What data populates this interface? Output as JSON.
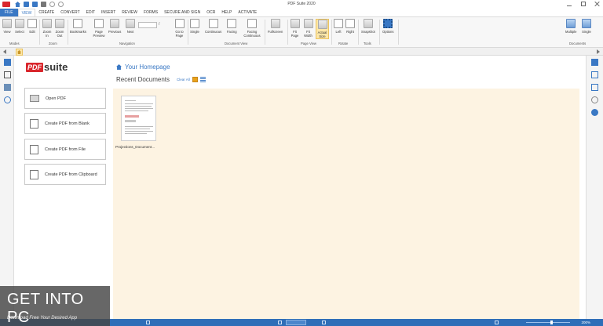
{
  "window": {
    "title": "PDF Suite 2020"
  },
  "menu": {
    "tabs": [
      "FILE",
      "VIEW",
      "CREATE",
      "CONVERT",
      "EDIT",
      "INSERT",
      "REVIEW",
      "FORMS",
      "SECURE AND SIGN",
      "OCR",
      "HELP",
      "ACTIVATE"
    ],
    "active": "VIEW"
  },
  "ribbon": {
    "buttons": [
      {
        "name": "view",
        "label": "View"
      },
      {
        "name": "select",
        "label": "Select"
      },
      {
        "name": "edit",
        "label": "Edit"
      },
      {
        "name": "zoom-in",
        "label": "Zoom In"
      },
      {
        "name": "zoom-out",
        "label": "Zoom Out"
      },
      {
        "name": "bookmarks",
        "label": "Bookmarks"
      },
      {
        "name": "page-preview",
        "label": "Page Preview"
      },
      {
        "name": "previous",
        "label": "Previous"
      },
      {
        "name": "next",
        "label": "Next"
      },
      {
        "name": "go-to-page",
        "label": "Go to Page"
      },
      {
        "name": "single",
        "label": "Single"
      },
      {
        "name": "continuous",
        "label": "Continuous"
      },
      {
        "name": "facing",
        "label": "Facing"
      },
      {
        "name": "facing-continuous",
        "label": "Facing Continuous"
      },
      {
        "name": "fullscreen",
        "label": "Fullscreen"
      },
      {
        "name": "fit-page",
        "label": "Fit Page"
      },
      {
        "name": "fit-width",
        "label": "Fit Width"
      },
      {
        "name": "actual-size",
        "label": "Actual Size"
      },
      {
        "name": "rotate-left",
        "label": "Left"
      },
      {
        "name": "rotate-right",
        "label": "Right"
      },
      {
        "name": "snapshot",
        "label": "Snapshot"
      },
      {
        "name": "options",
        "label": "Options"
      },
      {
        "name": "multiple",
        "label": "Multiple"
      },
      {
        "name": "single-doc",
        "label": "Single"
      }
    ],
    "page_separator": "/",
    "groups": [
      "Modes",
      "Zoom",
      "Navigation",
      "Document View",
      "Page View",
      "Rotate",
      "Tools",
      "Documents"
    ]
  },
  "brand": {
    "pdf": "PDF",
    "suite": "suite"
  },
  "home": {
    "heading": "Your Homepage",
    "recent_title": "Recent Documents",
    "clear_all": "Clear All",
    "actions": [
      "Open PDF",
      "Create PDF from Blank",
      "Create PDF from File",
      "Create PDF from Clipboard"
    ],
    "recent_files": [
      "Projections_Document..."
    ]
  },
  "status": {
    "search_placeholder": "Search",
    "zoom": "200%"
  },
  "watermark": {
    "main": "GET INTO PC",
    "tagline": "Download Free Your Desired App"
  },
  "colors": {
    "accent": "#3a78c4",
    "brand_red": "#d9262c",
    "recent_bg": "#fdf3e2",
    "highlight": "#fde7a8"
  }
}
